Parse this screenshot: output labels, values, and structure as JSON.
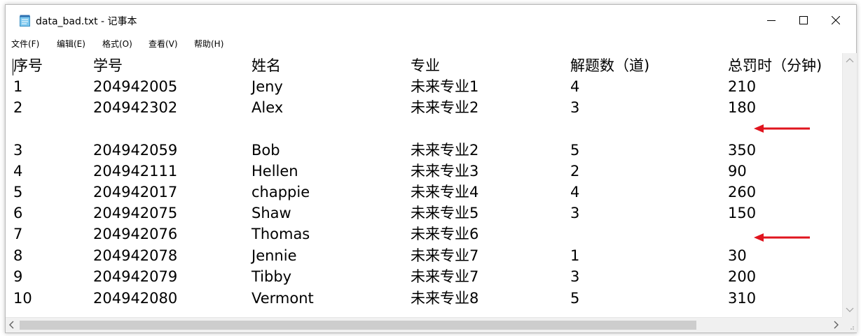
{
  "window": {
    "title": "data_bad.txt - 记事本"
  },
  "menu": [
    "文件(F)",
    "编辑(E)",
    "格式(O)",
    "查看(V)",
    "帮助(H)"
  ],
  "table": {
    "headers": [
      "序号",
      "学号",
      "姓名",
      "专业",
      "解题数（道)",
      "总罚时（分钟)"
    ],
    "rows": [
      [
        "1",
        "204942005",
        "Jeny",
        "未来专业1",
        "4",
        "210"
      ],
      [
        "2",
        "204942302",
        "Alex",
        "未来专业2",
        "3",
        "180"
      ],
      [
        "",
        "",
        "",
        "",
        "",
        ""
      ],
      [
        "3",
        "204942059",
        "Bob",
        "未来专业2",
        "5",
        "350"
      ],
      [
        "4",
        "204942111",
        "Hellen",
        "未来专业3",
        "2",
        "90"
      ],
      [
        "5",
        "204942017",
        "chappie",
        "未来专业4",
        "4",
        "260"
      ],
      [
        "6",
        "204942075",
        "Shaw",
        "未来专业5",
        "3",
        "150"
      ],
      [
        "7",
        "204942076",
        "Thomas",
        "未来专业6",
        "",
        ""
      ],
      [
        "8",
        "204942078",
        "Jennie",
        "未来专业7",
        "1",
        "30"
      ],
      [
        "9",
        "204942079",
        "Tibby",
        "未来专业7",
        "3",
        "200"
      ],
      [
        "10",
        "204942080",
        "Vermont",
        "未来专业8",
        "5",
        "310"
      ]
    ]
  },
  "annotations": {
    "arrow_color": "#e0141e",
    "arrow_rows": [
      2,
      7
    ]
  },
  "icons": {
    "app": "notepad-icon",
    "minimize": "minimize-icon",
    "maximize": "maximize-icon",
    "close": "close-icon",
    "scroll_up": "chevron-up-icon",
    "scroll_down": "chevron-down-icon",
    "scroll_left": "chevron-left-icon",
    "scroll_right": "chevron-right-icon"
  }
}
